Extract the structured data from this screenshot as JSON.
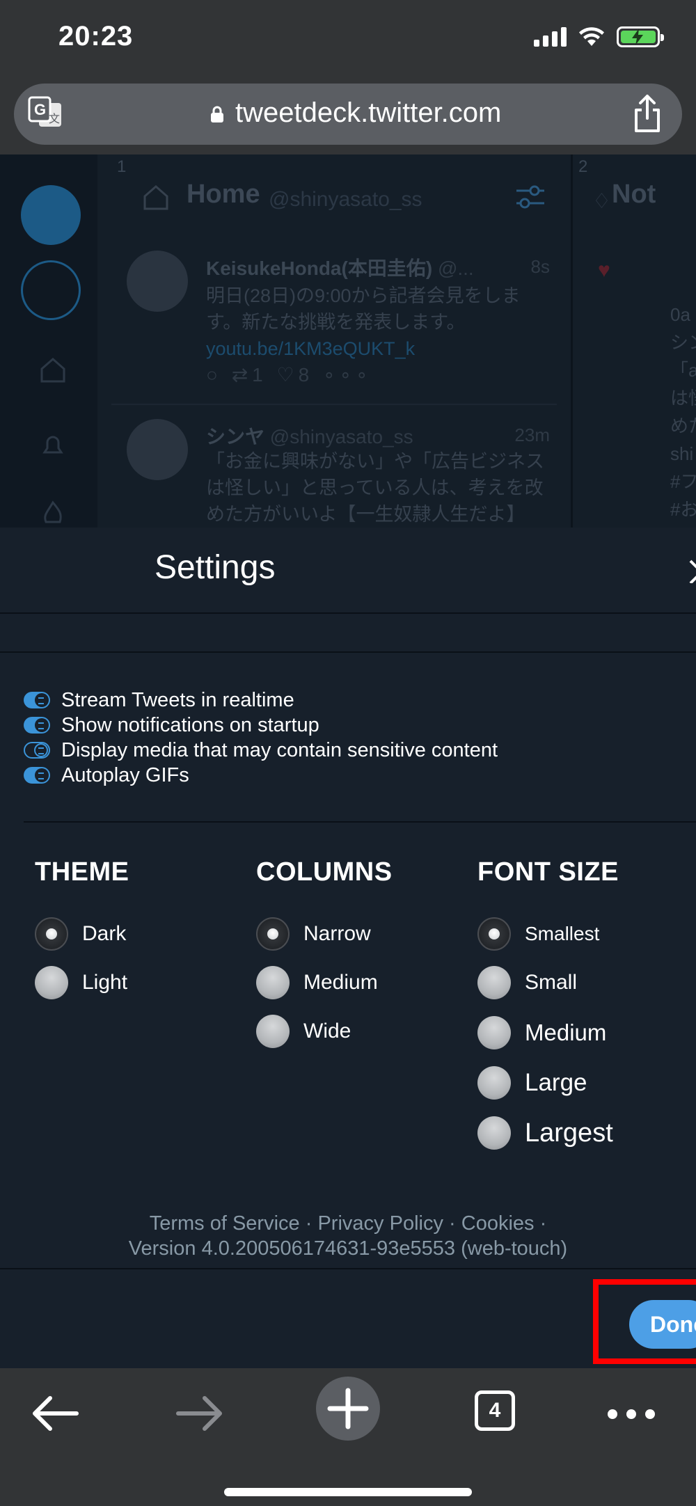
{
  "status_bar": {
    "time": "20:23"
  },
  "url_bar": {
    "url": "tweetdeck.twitter.com"
  },
  "background": {
    "columns": [
      {
        "number": "1",
        "title": "Home",
        "handle": "@shinyasato_ss"
      },
      {
        "number": "2",
        "title": "Not"
      }
    ],
    "tweets": [
      {
        "name": "KeisukeHonda(本田圭佑)",
        "handle": "@...",
        "time": "8s",
        "text": "明日(28日)の9:00から記者会見をします。新たな挑戦を発表します。",
        "link": "youtu.be/1KM3eQUKT_k",
        "retweets": "1",
        "likes": "8"
      },
      {
        "name": "シンヤ",
        "handle": "@shinyasato_ss",
        "time": "23m",
        "text": "「お金に興味がない」や「広告ビジネスは怪しい」と思っている人は、考えを改めた方がいいよ【一生奴隷人生だよ】"
      }
    ],
    "right_column_text": [
      "0a",
      "シン",
      "「a",
      "は怪",
      "めた",
      "shi",
      "#フ",
      "#お"
    ]
  },
  "settings": {
    "title": "Settings",
    "toggles": [
      {
        "label": "Stream Tweets in realtime",
        "on": true
      },
      {
        "label": "Show notifications on startup",
        "on": true
      },
      {
        "label": "Display media that may contain sensitive content",
        "on": false
      },
      {
        "label": "Autoplay GIFs",
        "on": true
      }
    ],
    "theme": {
      "heading": "THEME",
      "options": [
        "Dark",
        "Light"
      ],
      "selected": "Dark"
    },
    "columns": {
      "heading": "COLUMNS",
      "options": [
        "Narrow",
        "Medium",
        "Wide"
      ],
      "selected": "Narrow"
    },
    "font_size": {
      "heading": "FONT SIZE",
      "options": [
        "Smallest",
        "Small",
        "Medium",
        "Large",
        "Largest"
      ],
      "selected": "Smallest"
    },
    "footer": {
      "terms": "Terms of Service",
      "privacy": "Privacy Policy",
      "cookies": "Cookies",
      "separator": "·",
      "version": "Version 4.0.200506174631-93e5553 (web-touch)"
    },
    "done_label": "Done"
  },
  "toolbar": {
    "tab_count": "4"
  },
  "colors": {
    "accent": "#3b94d9",
    "done_button": "#4d9fe6",
    "highlight": "#ff0000",
    "modal_bg": "#17202b",
    "chrome_bg": "#323436"
  }
}
